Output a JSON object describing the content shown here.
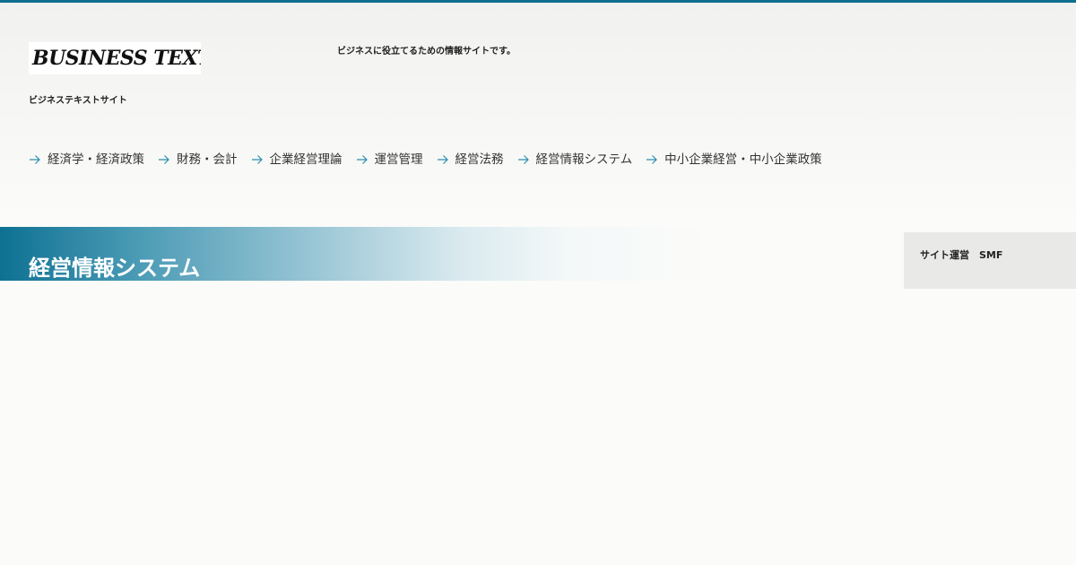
{
  "header": {
    "logo_text": "BUSINESS TEXT",
    "site_subtitle": "ビジネステキストサイト",
    "tagline": "ビジネスに役立てるための情報サイトです。"
  },
  "nav": {
    "items": [
      {
        "label": "経済学・経済政策"
      },
      {
        "label": "財務・会計"
      },
      {
        "label": "企業経営理論"
      },
      {
        "label": "運営管理"
      },
      {
        "label": "経営法務"
      },
      {
        "label": "経営情報システム"
      },
      {
        "label": "中小企業経営・中小企業政策"
      }
    ],
    "arrow_icon": "arrow-right-icon"
  },
  "category": {
    "title": "経営情報システム"
  },
  "sidebar": {
    "operator_text": "サイト運営　SMF"
  },
  "colors": {
    "accent": "#0c6f8f",
    "arrow": "#2a8fb0",
    "background": "#fbfbf9",
    "widget_bg": "#e9e9e7"
  }
}
